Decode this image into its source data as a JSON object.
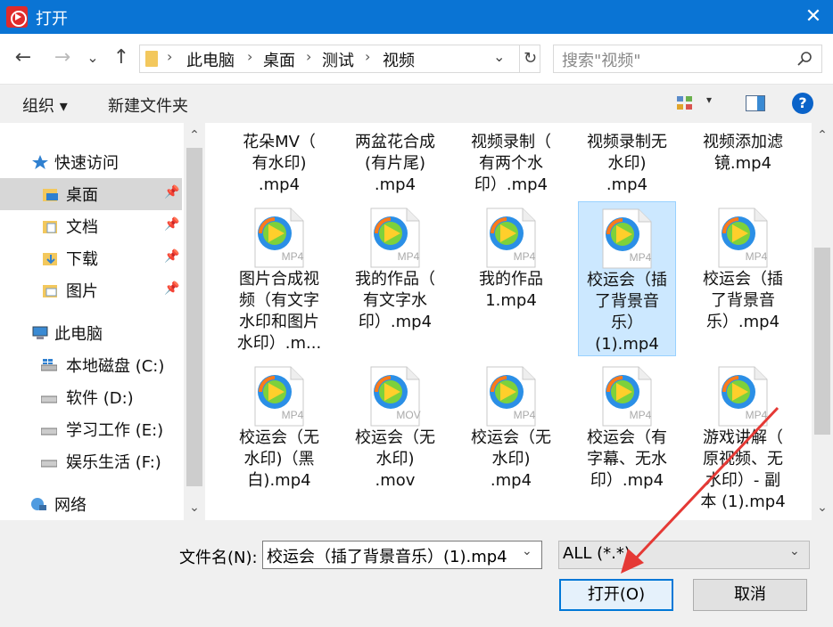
{
  "window": {
    "title": "打开",
    "close": "✕"
  },
  "nav": {
    "back": "←",
    "forward": "→",
    "recent": "⌄",
    "up": "↑",
    "breadcrumb": [
      "此电脑",
      "桌面",
      "测试",
      "视频"
    ],
    "separator": "›",
    "address_dropdown": "⌄",
    "refresh": "↻",
    "search_placeholder": "搜索\"视频\""
  },
  "toolbar": {
    "organize": "组织 ▾",
    "new_folder": "新建文件夹",
    "view_dropdown": "▾",
    "help": "?"
  },
  "sidebar": {
    "items": [
      {
        "label": "快速访问",
        "icon": "star-icon",
        "pinned": false
      },
      {
        "label": "桌面",
        "icon": "desktop-folder-icon",
        "pinned": true,
        "selected": true
      },
      {
        "label": "文档",
        "icon": "documents-folder-icon",
        "pinned": true
      },
      {
        "label": "下载",
        "icon": "downloads-folder-icon",
        "pinned": true
      },
      {
        "label": "图片",
        "icon": "pictures-folder-icon",
        "pinned": true
      },
      {
        "label": "此电脑",
        "icon": "computer-icon",
        "pinned": false
      },
      {
        "label": "本地磁盘 (C:)",
        "icon": "drive-icon",
        "pinned": false
      },
      {
        "label": "软件 (D:)",
        "icon": "drive-icon",
        "pinned": false
      },
      {
        "label": "学习工作 (E:)",
        "icon": "drive-icon",
        "pinned": false
      },
      {
        "label": "娱乐生活 (F:)",
        "icon": "drive-icon",
        "pinned": false
      },
      {
        "label": "网络",
        "icon": "network-icon",
        "pinned": false
      }
    ],
    "pin_glyph": "📌",
    "scroll_up": "⌃",
    "scroll_down": "⌄"
  },
  "files": {
    "row0": [
      {
        "name": [
          "花朵MV（",
          "有水印)",
          ".mp4"
        ]
      },
      {
        "name": [
          "两盆花合成",
          "(有片尾)",
          ".mp4"
        ]
      },
      {
        "name": [
          "视频录制（",
          "有两个水",
          "印）.mp4"
        ]
      },
      {
        "name": [
          "视频录制无",
          "水印)",
          ".mp4"
        ]
      },
      {
        "name": [
          "视频添加滤",
          "镜.mp4"
        ]
      }
    ],
    "row1": [
      {
        "name": [
          "图片合成视",
          "频（有文字",
          "水印和图片",
          "水印）.m..."
        ],
        "ext": "MP4"
      },
      {
        "name": [
          "我的作品（",
          "有文字水",
          "印）.mp4"
        ],
        "ext": "MP4"
      },
      {
        "name": [
          "我的作品",
          "1.mp4"
        ],
        "ext": "MP4"
      },
      {
        "name": [
          "校运会（插",
          "了背景音",
          "乐）",
          "(1).mp4"
        ],
        "ext": "MP4",
        "selected": true
      },
      {
        "name": [
          "校运会（插",
          "了背景音",
          "乐）.mp4"
        ],
        "ext": "MP4"
      }
    ],
    "row2": [
      {
        "name": [
          "校运会（无",
          "水印)（黑",
          "白).mp4"
        ],
        "ext": "MP4"
      },
      {
        "name": [
          "校运会（无",
          "水印)",
          ".mov"
        ],
        "ext": "MOV"
      },
      {
        "name": [
          "校运会（无",
          "水印)",
          ".mp4"
        ],
        "ext": "MP4"
      },
      {
        "name": [
          "校运会（有",
          "字幕、无水",
          "印）.mp4"
        ],
        "ext": "MP4"
      },
      {
        "name": [
          "游戏讲解（",
          "原视频、无",
          "水印）- 副",
          "本 (1).mp4"
        ],
        "ext": "MP4"
      }
    ]
  },
  "bottom": {
    "filename_label": "文件名(N):",
    "filename_value": "校运会（插了背景音乐）(1).mp4",
    "filetype_value": "ALL (*.*)",
    "dropdown": "⌄",
    "open_button": "打开(O)",
    "cancel_button": "取消"
  },
  "colors": {
    "titlebar": "#0a74d4",
    "selection": "#cce8ff",
    "annotation_arrow": "#e53935"
  }
}
